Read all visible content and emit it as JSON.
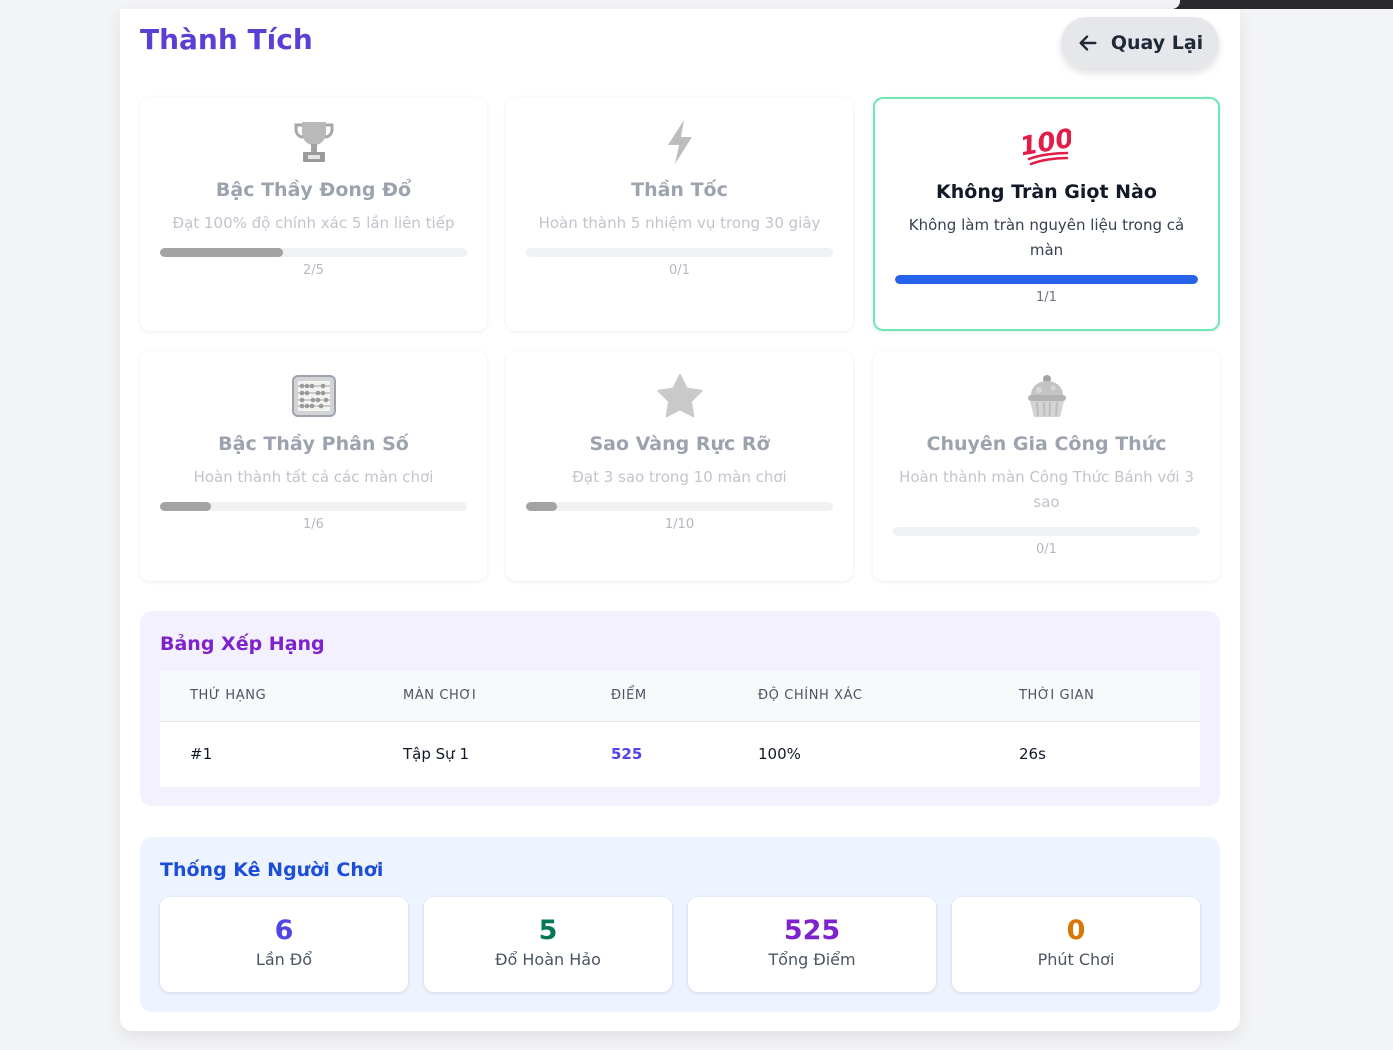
{
  "header": {
    "title": "Thành Tích",
    "back_label": "Quay Lại"
  },
  "achievements": [
    {
      "icon": "trophy-icon",
      "title": "Bậc Thầy Đong Đổ",
      "desc": "Đạt 100% độ chính xác 5 lần liên tiếp",
      "progress": 0.4,
      "count": "2/5",
      "done": false
    },
    {
      "icon": "lightning-icon",
      "title": "Thần Tốc",
      "desc": "Hoàn thành 5 nhiệm vụ trong 30 giây",
      "progress": 0,
      "count": "0/1",
      "done": false
    },
    {
      "icon": "hundred-points-icon",
      "title": "Không Tràn Giọt Nào",
      "desc": "Không làm tràn nguyên liệu trong cả màn",
      "progress": 1,
      "count": "1/1",
      "done": true
    },
    {
      "icon": "abacus-icon",
      "title": "Bậc Thầy Phân Số",
      "desc": "Hoàn thành tất cả các màn chơi",
      "progress": 0.1667,
      "count": "1/6",
      "done": false
    },
    {
      "icon": "star-icon",
      "title": "Sao Vàng Rực Rỡ",
      "desc": "Đạt 3 sao trong 10 màn chơi",
      "progress": 0.1,
      "count": "1/10",
      "done": false
    },
    {
      "icon": "cupcake-icon",
      "title": "Chuyên Gia Công Thức",
      "desc": "Hoàn thành màn Công Thức Bánh với 3 sao",
      "progress": 0,
      "count": "0/1",
      "done": false
    }
  ],
  "leaderboard": {
    "title": "Bảng Xếp Hạng",
    "columns": [
      "THỨ HẠNG",
      "MÀN CHƠI",
      "ĐIỂM",
      "ĐỘ CHÍNH XÁC",
      "THỜI GIAN"
    ],
    "rows": [
      {
        "rank": "#1",
        "level": "Tập Sự 1",
        "score": "525",
        "accuracy": "100%",
        "time": "26s"
      }
    ]
  },
  "stats": {
    "title": "Thống Kê Người Chơi",
    "items": [
      {
        "value": "6",
        "label": "Lần Đổ",
        "color": "#4f46e5"
      },
      {
        "value": "5",
        "label": "Đổ Hoàn Hảo",
        "color": "#047857"
      },
      {
        "value": "525",
        "label": "Tổng Điểm",
        "color": "#7e22ce"
      },
      {
        "value": "0",
        "label": "Phút Chơi",
        "color": "#d97706"
      }
    ]
  }
}
